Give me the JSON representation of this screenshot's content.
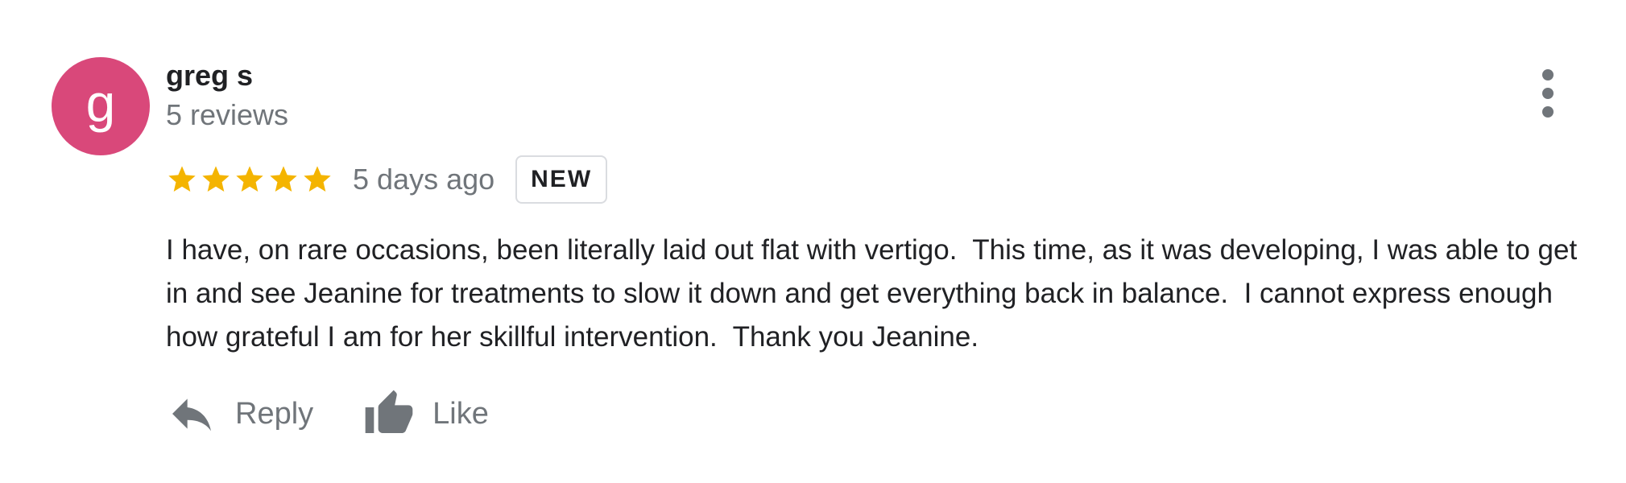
{
  "author": {
    "avatar_letter": "g",
    "avatar_color": "#d9487a",
    "name": "greg s",
    "review_count": "5 reviews"
  },
  "rating": {
    "stars": 5,
    "max_stars": 5,
    "star_color": "#f4b400"
  },
  "meta": {
    "date": "5 days ago",
    "badge": "NEW"
  },
  "review": {
    "text": "I have, on rare occasions, been literally laid out flat with vertigo.  This time, as it was developing, I was able to get in and see Jeanine for treatments to slow it down and get everything back in balance.  I cannot express enough how grateful I am for her skillful intervention.  Thank you Jeanine."
  },
  "actions": {
    "reply_label": "Reply",
    "reply_icon": "reply-icon",
    "like_label": "Like",
    "like_icon": "thumbs-up-icon"
  },
  "menu": {
    "icon": "more-vert-icon"
  }
}
